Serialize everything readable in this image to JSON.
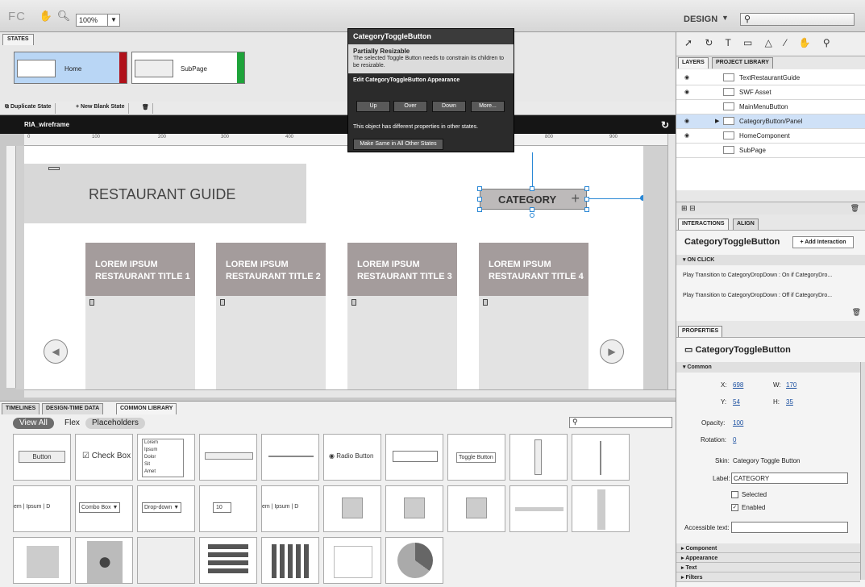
{
  "topbar": {
    "logo": "FC",
    "zoom": "100%",
    "workspace": "DESIGN"
  },
  "states": {
    "tab": "STATES",
    "items": [
      {
        "label": "Home",
        "color": "#b0111a"
      },
      {
        "label": "SubPage",
        "color": "#1ea33a"
      }
    ],
    "duplicate_label": "Duplicate State",
    "new_label": "New Blank State"
  },
  "canvas": {
    "title": "RIA_wireframe",
    "ruler_ticks": [
      "0",
      "100",
      "200",
      "300",
      "400",
      "800",
      "900"
    ],
    "header": "RESTAURANT GUIDE",
    "cards": [
      {
        "line1": "LOREM IPSUM",
        "line2": "RESTAURANT TITLE 1"
      },
      {
        "line1": "LOREM IPSUM",
        "line2": "RESTAURANT TITLE 2"
      },
      {
        "line1": "LOREM IPSUM",
        "line2": "RESTAURANT TITLE 3"
      },
      {
        "line1": "LOREM IPSUM",
        "line2": "RESTAURANT TITLE 4"
      }
    ],
    "category_label": "CATEGORY"
  },
  "popover": {
    "title": "CategoryToggleButton",
    "heading": "Partially Resizable",
    "message": "The selected Toggle Button needs to constrain its children to be resizable.",
    "edit_heading": "Edit CategoryToggleButton Appearance",
    "buttons": [
      "Up",
      "Over",
      "Down",
      "More..."
    ],
    "note": "This object has different properties in other states.",
    "make_same": "Make Same in All Other States"
  },
  "library": {
    "tabs": [
      "TIMELINES",
      "DESIGN-TIME DATA",
      "COMMON LIBRARY"
    ],
    "filters": [
      "View All",
      "Flex",
      "Placeholders"
    ],
    "tiles_row1": [
      "Button",
      "Check Box",
      "",
      "",
      "",
      "Radio Button",
      "",
      "Toggle Button",
      "",
      ""
    ],
    "list_items": [
      "Lorem",
      "Ipsum",
      "Dolor",
      "Sit",
      "Amet"
    ],
    "tiles_row2": [
      "Combo Box",
      "Drop-down",
      "10"
    ],
    "tab_texts": [
      "em",
      "Ipsum",
      "D"
    ]
  },
  "right": {
    "layer_tabs": [
      "LAYERS",
      "PROJECT LIBRARY"
    ],
    "layers": [
      "TextRestaurantGuide",
      "SWF Asset",
      "MainMenuButton",
      "CategoryButton/Panel",
      "HomeComponent",
      "SubPage"
    ],
    "interaction_tabs": [
      "INTERACTIONS",
      "ALIGN"
    ],
    "component_name": "CategoryToggleButton",
    "add_interaction": "+ Add Interaction",
    "on_click": "ON CLICK",
    "interactions": [
      "Play Transition to CategoryDropDown : On if CategoryDro...",
      "Play Transition to CategoryDropDown : Off if CategoryDro..."
    ],
    "properties_tab": "PROPERTIES",
    "common": "Common",
    "x_lbl": "X:",
    "x": "698",
    "w_lbl": "W:",
    "w": "170",
    "y_lbl": "Y:",
    "y": "54",
    "h_lbl": "H:",
    "h": "35",
    "opacity_lbl": "Opacity:",
    "opacity": "100",
    "rotation_lbl": "Rotation:",
    "rotation": "0",
    "skin_lbl": "Skin:",
    "skin": "Category Toggle Button",
    "label_lbl": "Label:",
    "label": "CATEGORY",
    "selected": "Selected",
    "enabled": "Enabled",
    "accessible_lbl": "Accessible text:",
    "sections": [
      "Component",
      "Appearance",
      "Text",
      "Filters"
    ]
  }
}
